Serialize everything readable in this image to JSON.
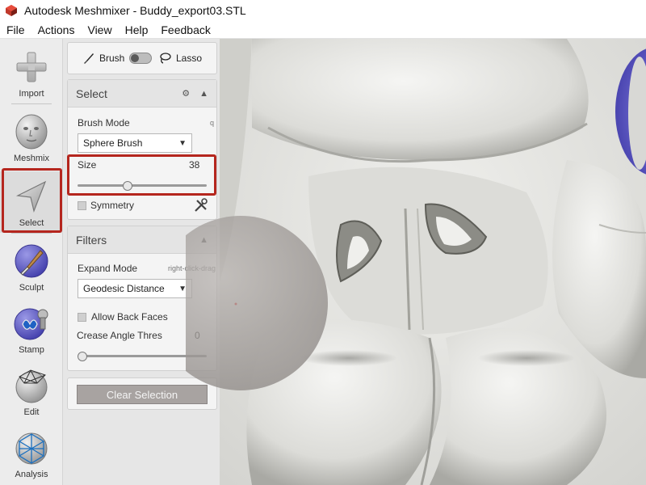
{
  "window": {
    "title": "Autodesk Meshmixer - Buddy_export03.STL"
  },
  "menu": [
    "File",
    "Actions",
    "View",
    "Help",
    "Feedback"
  ],
  "toolbar": {
    "tools": [
      {
        "label": "Import",
        "icon": "plus-icon"
      },
      {
        "label": "Meshmix",
        "icon": "head-icon"
      },
      {
        "label": "Select",
        "icon": "arrow-cursor-icon",
        "active": true
      },
      {
        "label": "Sculpt",
        "icon": "brush-icon"
      },
      {
        "label": "Stamp",
        "icon": "stamp-icon"
      },
      {
        "label": "Edit",
        "icon": "wireframe-icon"
      },
      {
        "label": "Analysis",
        "icon": "mesh-analysis-icon"
      }
    ]
  },
  "mode_switch": {
    "brush_label": "Brush",
    "lasso_label": "Lasso"
  },
  "select_panel": {
    "title": "Select",
    "brush_mode_label": "Brush Mode",
    "brush_mode_hint": "q",
    "brush_mode_value": "Sphere Brush",
    "size_label": "Size",
    "size_value": "38",
    "symmetry_label": "Symmetry"
  },
  "filters_panel": {
    "title": "Filters",
    "expand_mode_label": "Expand Mode",
    "expand_mode_hint": "right-click-drag",
    "expand_mode_value": "Geodesic Distance",
    "allow_back_faces_label": "Allow Back Faces",
    "crease_angle_label": "Crease Angle Thres",
    "crease_angle_value": "0"
  },
  "clear_selection_label": "Clear Selection",
  "colors": {
    "highlight": "#b5261e",
    "accent_purple": "#6f6ad8",
    "mesh": "#d9d9d6"
  }
}
